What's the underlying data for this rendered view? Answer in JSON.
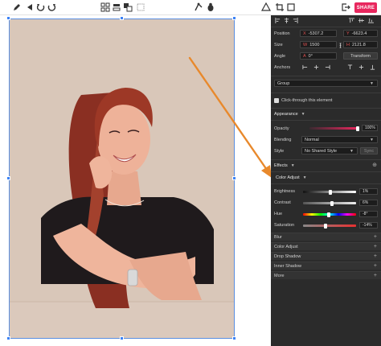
{
  "toolbar": {
    "share_label": "SHARE",
    "icons": [
      "pen-icon",
      "back-icon",
      "undo-icon",
      "redo-icon",
      "grid-icon",
      "distribute-icon",
      "arrange-icon",
      "align-icon",
      "node-icon",
      "bug-icon",
      "shapes-icon",
      "crop-icon",
      "export-icon"
    ]
  },
  "inspector": {
    "position": {
      "label": "Position",
      "x_prefix": "X",
      "x_value": "-5307.2",
      "y_prefix": "Y",
      "y_value": "-6623.4"
    },
    "size": {
      "label": "Size",
      "w_prefix": "W",
      "w_value": "1500",
      "h_prefix": "H",
      "h_value": "2121.8"
    },
    "angle": {
      "label": "Angle",
      "prefix": "A",
      "value": "0°",
      "transform_label": "Transform"
    },
    "anchors": {
      "label": "Anchors"
    },
    "group_select": "Group",
    "click_through_label": "Click-through this element",
    "appearance": {
      "title": "Appearance",
      "opacity_label": "Opacity",
      "opacity_value": "100%",
      "opacity_level": 1.0,
      "blending_label": "Blending",
      "blending_value": "Normal",
      "style_label": "Style",
      "style_value": "No Shared Style",
      "sync_label": "Sync"
    },
    "effects": {
      "title": "Effects",
      "color_adjust_title": "Color Adjust",
      "sliders": [
        {
          "label": "Brightness",
          "value": "1%",
          "level": 0.51
        },
        {
          "label": "Contrast",
          "value": "6%",
          "level": 0.55
        },
        {
          "label": "Hue",
          "value": "-8°",
          "level": 0.48
        },
        {
          "label": "Saturation",
          "value": "-14%",
          "level": 0.43
        }
      ],
      "items": [
        "Blur",
        "Color Adjust",
        "Drop Shadow",
        "Inner Shadow",
        "More"
      ]
    }
  },
  "colors": {
    "accent": "#e8275e",
    "panel_bg": "#2b2b2b",
    "selection": "#3b82f6",
    "arrow": "#e8892c"
  }
}
